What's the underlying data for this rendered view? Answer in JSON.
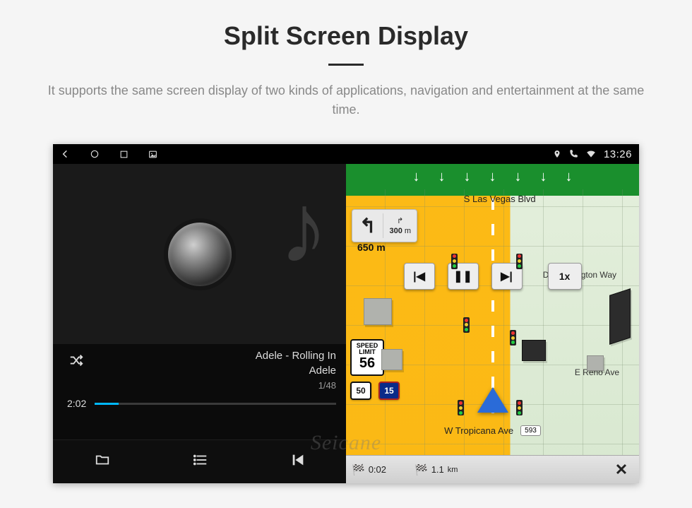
{
  "header": {
    "title": "Split Screen Display",
    "subtitle": "It supports the same screen display of two kinds of applications, navigation and entertainment at the same time."
  },
  "statusbar": {
    "time": "13:26"
  },
  "music": {
    "track_title": "Adele - Rolling In",
    "artist": "Adele",
    "track_index": "1/48",
    "elapsed": "2:02"
  },
  "nav": {
    "lane_arrow": "↓",
    "turn_primary": "↰",
    "turn_primary_dist": "650 m",
    "turn_next": "↱",
    "turn_next_dist_value": "300",
    "turn_next_dist_unit": "m",
    "speed_limit_label1": "SPEED",
    "speed_limit_label2": "LIMIT",
    "speed_limit_value": "56",
    "route_shield_us": "50",
    "route_shield_interstate": "15",
    "street_top": "S Las Vegas Blvd",
    "street_mid": "Duke Ellington Way",
    "street_mid2": "E Reno Ave",
    "street_bottom": "W Tropicana Ave",
    "exit_badge": "593",
    "controls": {
      "prev": "|◀",
      "pause": "❚❚",
      "next": "▶|",
      "speed": "1x"
    },
    "bottom": {
      "eta": "0:02",
      "distance": "1.1",
      "distance_unit": "km",
      "close": "✕"
    }
  },
  "watermark": "Seicane"
}
